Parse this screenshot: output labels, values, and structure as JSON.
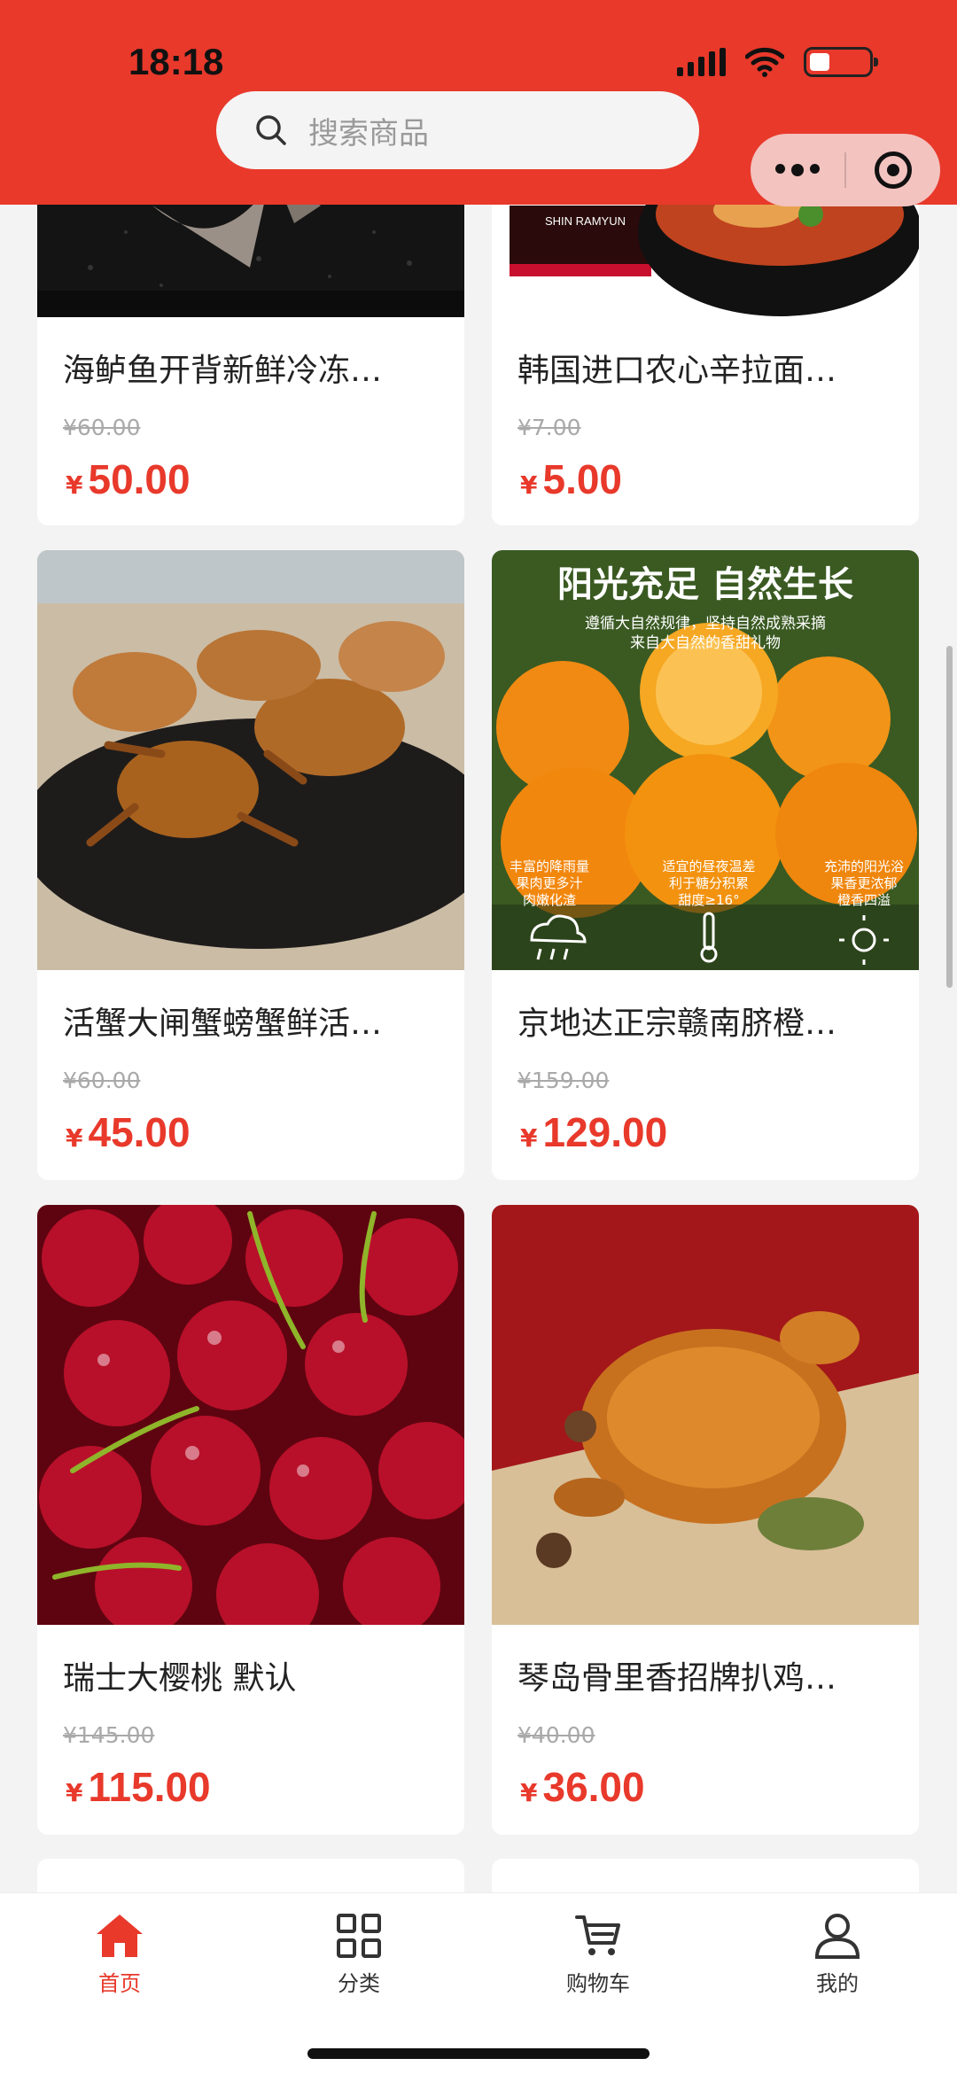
{
  "status_bar": {
    "time": "18:18"
  },
  "search": {
    "placeholder": "搜索商品"
  },
  "products": [
    {
      "name": "海鲈鱼开背新鲜冷冻…",
      "original_price": "¥60.00",
      "price_symbol": "¥",
      "price": "50.00",
      "image_icon": "fish-photo"
    },
    {
      "name": "韩国进口农心辛拉面…",
      "original_price": "¥7.00",
      "price_symbol": "¥",
      "price": "5.00",
      "image_icon": "ramen-photo",
      "image_label": "SHIN RAMYUN"
    },
    {
      "name": "活蟹大闸蟹螃蟹鲜活…",
      "original_price": "¥60.00",
      "price_symbol": "¥",
      "price": "45.00",
      "image_icon": "crab-photo"
    },
    {
      "name": "京地达正宗赣南脐橙…",
      "original_price": "¥159.00",
      "price_symbol": "¥",
      "price": "129.00",
      "image_icon": "orange-photo",
      "image_title": "阳光充足 自然生长",
      "image_subtitle_1": "遵循大自然规律，坚持自然成熟采摘",
      "image_subtitle_2": "来自大自然的香甜礼物",
      "image_features": [
        {
          "line1": "丰富的降雨量",
          "line2": "果肉更多汁",
          "line3": "肉嫩化渣"
        },
        {
          "line1": "适宜的昼夜温差",
          "line2": "利于糖分积累",
          "line3": "甜度≥16°"
        },
        {
          "line1": "充沛的阳光浴",
          "line2": "果香更浓郁",
          "line3": "橙香四溢"
        }
      ]
    },
    {
      "name": "瑞士大樱桃 默认",
      "original_price": "¥145.00",
      "price_symbol": "¥",
      "price": "115.00",
      "image_icon": "cherry-photo"
    },
    {
      "name": "琴岛骨里香招牌扒鸡…",
      "original_price": "¥40.00",
      "price_symbol": "¥",
      "price": "36.00",
      "image_icon": "chicken-photo"
    }
  ],
  "tabbar": {
    "items": [
      {
        "label": "首页",
        "icon": "home-icon",
        "active": true
      },
      {
        "label": "分类",
        "icon": "grid-icon",
        "active": false
      },
      {
        "label": "购物车",
        "icon": "cart-icon",
        "active": false
      },
      {
        "label": "我的",
        "icon": "user-icon",
        "active": false
      }
    ]
  },
  "colors": {
    "accent": "#e8392b",
    "header": "#e8392b",
    "capsule": "#f3c3c0"
  }
}
